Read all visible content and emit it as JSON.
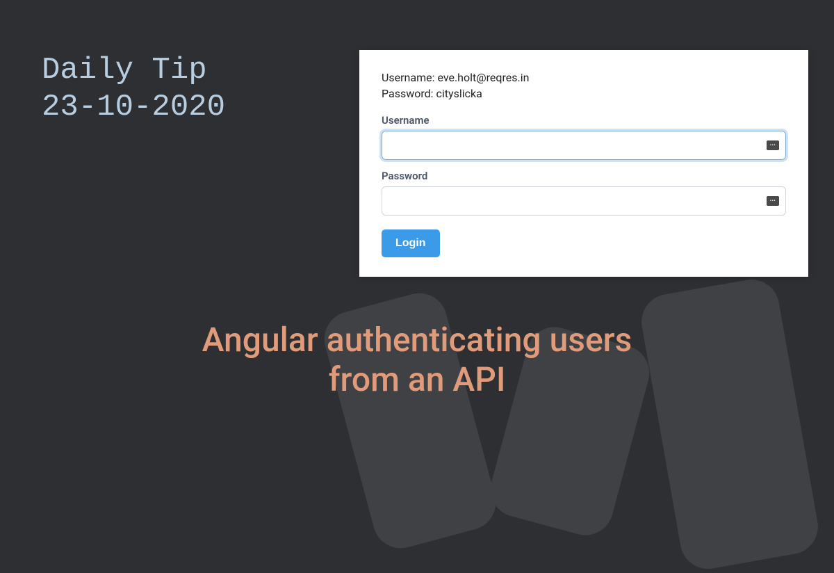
{
  "header": {
    "line1": "Daily Tip",
    "line2": "23-10-2020"
  },
  "form": {
    "hint_username_label": "Username: ",
    "hint_username_value": "eve.holt@reqres.in",
    "hint_password_label": "Password: ",
    "hint_password_value": "cityslicka",
    "username_label": "Username",
    "password_label": "Password",
    "username_value": "",
    "password_value": "",
    "login_button": "Login"
  },
  "title": {
    "line1": "Angular authenticating users",
    "line2": "from an API"
  },
  "colors": {
    "background": "#2d2f33",
    "accent_text": "#b8cde0",
    "title_color": "#e09b7a",
    "button_bg": "#3b9be8"
  }
}
